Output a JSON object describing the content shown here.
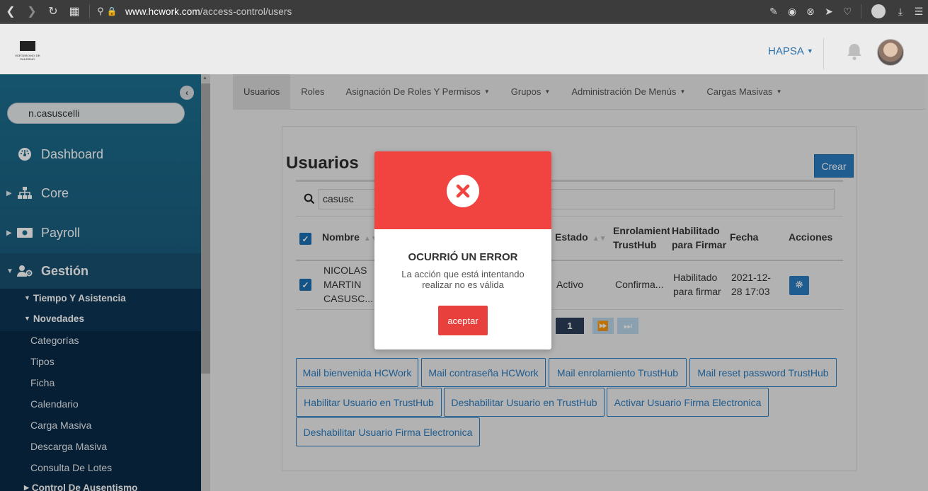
{
  "browser": {
    "url_domain": "www.hcwork.com",
    "url_path": "/access-control/users"
  },
  "header": {
    "logo_text": "HIPÓDROMO DE PALERMO",
    "company": "HAPSA"
  },
  "sidebar": {
    "user": "n.casuscelli",
    "items": [
      {
        "label": "Dashboard"
      },
      {
        "label": "Core"
      },
      {
        "label": "Payroll"
      },
      {
        "label": "Gestión"
      }
    ],
    "subheads": [
      "Tiempo Y Asistencia",
      "Novedades"
    ],
    "subitems": [
      "Categorías",
      "Tipos",
      "Ficha",
      "Calendario",
      "Carga Masiva",
      "Descarga Masiva",
      "Consulta De Lotes"
    ],
    "last_item": "Control De Ausentismo"
  },
  "tabs": [
    {
      "label": "Usuarios",
      "active": true
    },
    {
      "label": "Roles"
    },
    {
      "label": "Asignación De Roles Y Permisos"
    },
    {
      "label": "Grupos"
    },
    {
      "label": "Administración De Menús"
    },
    {
      "label": "Cargas Masivas"
    }
  ],
  "page": {
    "title": "Usuarios",
    "create_label": "Crear",
    "search_value": "casusc"
  },
  "table": {
    "headers": {
      "nombre": "Nombre",
      "estado": "Estado",
      "enrolamiento": [
        "Enrolamient",
        "TrustHub"
      ],
      "habilitado": [
        "Habilitado",
        "para Firmar"
      ],
      "fecha": "Fecha",
      "acciones": "Acciones"
    },
    "row": {
      "nombre": [
        "NICOLAS",
        "MARTIN",
        "CASUSC..."
      ],
      "estado": "Activo",
      "enrolamiento": "Confirma...",
      "habilitado": [
        "Habilitado",
        "para firmar"
      ],
      "fecha": [
        "2021-12-",
        "28 17:03"
      ]
    }
  },
  "pagination": {
    "current": "1"
  },
  "actions": [
    "Mail bienvenida HCWork",
    "Mail contraseña HCWork",
    "Mail enrolamiento TrustHub",
    "Mail reset password TrustHub",
    "Habilitar Usuario en TrustHub",
    "Deshabilitar Usuario en TrustHub",
    "Activar Usuario Firma Electronica",
    "Deshabilitar Usuario Firma Electronica"
  ],
  "modal": {
    "title": "OCURRIÓ UN ERROR",
    "message_line1": "La acción que está intentando",
    "message_line2": "realizar no es válida",
    "button": "aceptar"
  },
  "colors": {
    "sidebar": "#1c6f90",
    "accent": "#2a7bbf",
    "error": "#f1433f"
  }
}
